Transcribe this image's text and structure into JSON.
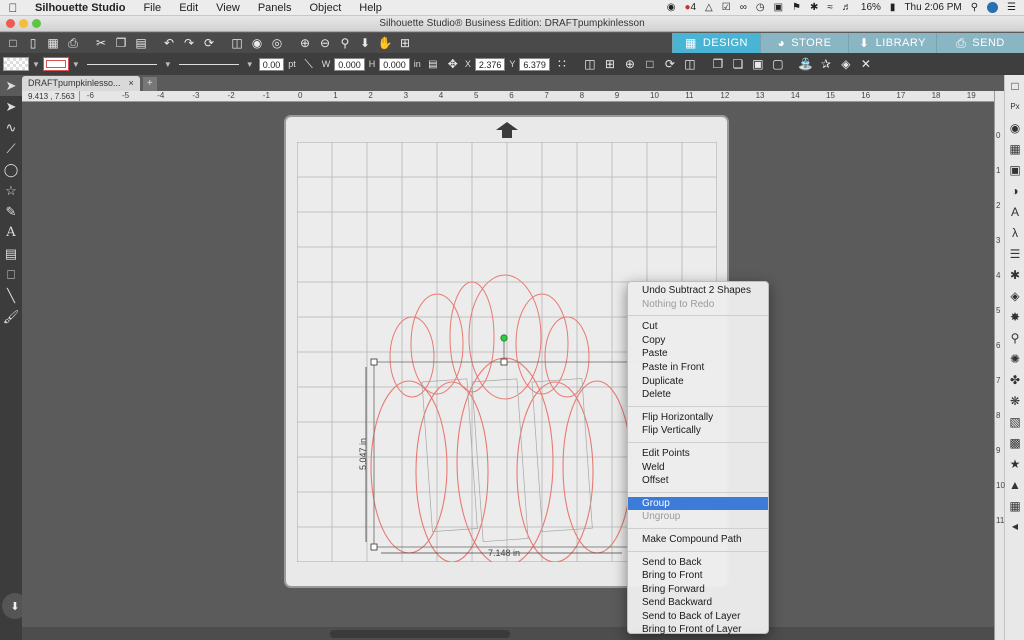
{
  "menubar": {
    "app_name": "Silhouette Studio",
    "items": [
      "File",
      "Edit",
      "View",
      "Panels",
      "Object",
      "Help"
    ],
    "status": {
      "badge_count": "4",
      "battery": "16%",
      "clock": "Thu 2:06 PM"
    }
  },
  "window": {
    "title": "Silhouette Studio® Business Edition: DRAFTpumpkinlesson"
  },
  "toolbar": {
    "tabs": [
      {
        "label": "DESIGN",
        "icon": "design-grid-icon"
      },
      {
        "label": "STORE",
        "icon": "store-icon"
      },
      {
        "label": "LIBRARY",
        "icon": "library-icon"
      },
      {
        "label": "SEND",
        "icon": "send-icon"
      }
    ],
    "active_tab": "DESIGN",
    "line_width": "0.00",
    "line_unit": "pt",
    "w_label": "W",
    "w_value": "0.000",
    "h_label": "H",
    "h_value": "0.000",
    "h_unit": "in",
    "x_label": "X",
    "x_value": "2.376",
    "y_label": "Y",
    "y_value": "6.379",
    "fill_color": "#ffffff",
    "line_color": "#e05050"
  },
  "document": {
    "tab_name": "DRAFTpumpkinlesso...",
    "close": "×",
    "add": "+",
    "cursor_coords": "9.413 , 7.563"
  },
  "ruler": {
    "h_ticks": [
      "-6",
      "-5",
      "-4",
      "-3",
      "-2",
      "-1",
      "0",
      "1",
      "2",
      "3",
      "4",
      "5",
      "6",
      "7",
      "8",
      "9",
      "10",
      "11",
      "12",
      "13",
      "14",
      "15",
      "16",
      "17",
      "18",
      "19"
    ],
    "v_ticks": [
      "0",
      "1",
      "2",
      "3",
      "4",
      "5",
      "6",
      "7",
      "8",
      "9",
      "10",
      "11"
    ]
  },
  "selection": {
    "height_label": "5.047 in",
    "width_label": "7.148 in",
    "shape_color": "#e87a72"
  },
  "context_menu": {
    "items": [
      {
        "label": "Undo Subtract 2 Shapes",
        "enabled": true
      },
      {
        "label": "Nothing to Redo",
        "enabled": false
      },
      {
        "separator": true
      },
      {
        "label": "Cut",
        "enabled": true
      },
      {
        "label": "Copy",
        "enabled": true
      },
      {
        "label": "Paste",
        "enabled": true
      },
      {
        "label": "Paste in Front",
        "enabled": true
      },
      {
        "label": "Duplicate",
        "enabled": true
      },
      {
        "label": "Delete",
        "enabled": true
      },
      {
        "separator": true
      },
      {
        "label": "Flip Horizontally",
        "enabled": true
      },
      {
        "label": "Flip Vertically",
        "enabled": true
      },
      {
        "separator": true
      },
      {
        "label": "Edit Points",
        "enabled": true
      },
      {
        "label": "Weld",
        "enabled": true
      },
      {
        "label": "Offset",
        "enabled": true
      },
      {
        "separator": true
      },
      {
        "label": "Group",
        "enabled": true,
        "highlighted": true
      },
      {
        "label": "Ungroup",
        "enabled": false
      },
      {
        "separator": true
      },
      {
        "label": "Make Compound Path",
        "enabled": true
      },
      {
        "separator": true
      },
      {
        "label": "Send to Back",
        "enabled": true
      },
      {
        "label": "Bring to Front",
        "enabled": true
      },
      {
        "label": "Bring Forward",
        "enabled": true
      },
      {
        "label": "Send Backward",
        "enabled": true
      },
      {
        "label": "Send to Back of Layer",
        "enabled": true
      },
      {
        "label": "Bring to Front of Layer",
        "enabled": true
      }
    ]
  }
}
